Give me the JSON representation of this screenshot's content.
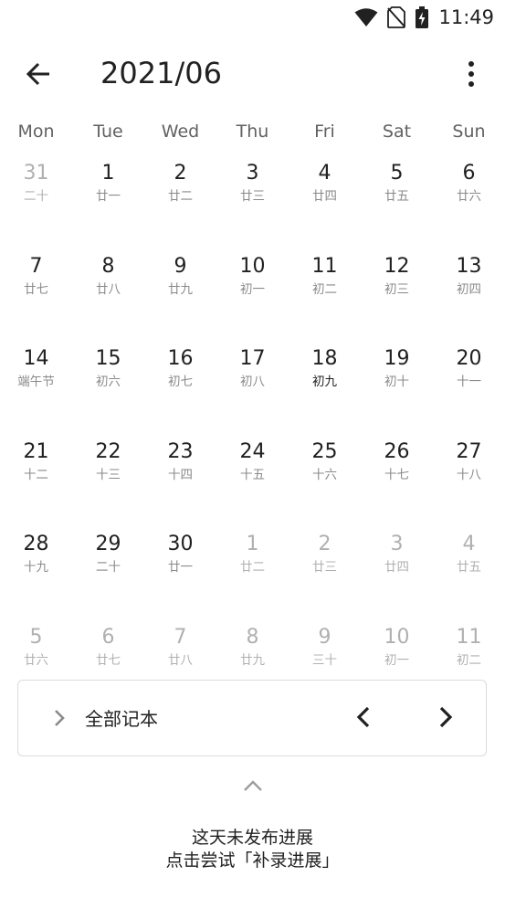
{
  "status_bar": {
    "time": "11:49",
    "icons": [
      "wifi-icon",
      "no-sim-icon",
      "battery-charging-icon"
    ]
  },
  "header": {
    "title": "2021/06",
    "back_icon": "arrow-left-icon",
    "menu_icon": "more-vertical-icon"
  },
  "weekdays": [
    "Mon",
    "Tue",
    "Wed",
    "Thu",
    "Fri",
    "Sat",
    "Sun"
  ],
  "weeks": [
    [
      {
        "day": "31",
        "lunar": "二十",
        "outside": true
      },
      {
        "day": "1",
        "lunar": "廿一"
      },
      {
        "day": "2",
        "lunar": "廿二"
      },
      {
        "day": "3",
        "lunar": "廿三"
      },
      {
        "day": "4",
        "lunar": "廿四"
      },
      {
        "day": "5",
        "lunar": "廿五"
      },
      {
        "day": "6",
        "lunar": "廿六"
      }
    ],
    [
      {
        "day": "7",
        "lunar": "廿七"
      },
      {
        "day": "8",
        "lunar": "廿八"
      },
      {
        "day": "9",
        "lunar": "廿九"
      },
      {
        "day": "10",
        "lunar": "初一"
      },
      {
        "day": "11",
        "lunar": "初二"
      },
      {
        "day": "12",
        "lunar": "初三"
      },
      {
        "day": "13",
        "lunar": "初四"
      }
    ],
    [
      {
        "day": "14",
        "lunar": "端午节"
      },
      {
        "day": "15",
        "lunar": "初六"
      },
      {
        "day": "16",
        "lunar": "初七"
      },
      {
        "day": "17",
        "lunar": "初八"
      },
      {
        "day": "18",
        "lunar": "初九",
        "today": true
      },
      {
        "day": "19",
        "lunar": "初十"
      },
      {
        "day": "20",
        "lunar": "十一"
      }
    ],
    [
      {
        "day": "21",
        "lunar": "十二"
      },
      {
        "day": "22",
        "lunar": "十三"
      },
      {
        "day": "23",
        "lunar": "十四"
      },
      {
        "day": "24",
        "lunar": "十五"
      },
      {
        "day": "25",
        "lunar": "十六"
      },
      {
        "day": "26",
        "lunar": "十七"
      },
      {
        "day": "27",
        "lunar": "十八"
      }
    ],
    [
      {
        "day": "28",
        "lunar": "十九"
      },
      {
        "day": "29",
        "lunar": "二十"
      },
      {
        "day": "30",
        "lunar": "廿一"
      },
      {
        "day": "1",
        "lunar": "廿二",
        "outside": true
      },
      {
        "day": "2",
        "lunar": "廿三",
        "outside": true
      },
      {
        "day": "3",
        "lunar": "廿四",
        "outside": true
      },
      {
        "day": "4",
        "lunar": "廿五",
        "outside": true
      }
    ],
    [
      {
        "day": "5",
        "lunar": "廿六",
        "outside": true
      },
      {
        "day": "6",
        "lunar": "廿七",
        "outside": true
      },
      {
        "day": "7",
        "lunar": "廿八",
        "outside": true
      },
      {
        "day": "8",
        "lunar": "廿九",
        "outside": true
      },
      {
        "day": "9",
        "lunar": "三十",
        "outside": true
      },
      {
        "day": "10",
        "lunar": "初一",
        "outside": true
      },
      {
        "day": "11",
        "lunar": "初二",
        "outside": true
      }
    ]
  ],
  "notebook_bar": {
    "label": "全部记本",
    "expand_icon": "chevron-right-icon",
    "prev_icon": "chevron-left-icon",
    "next_icon": "chevron-right-icon"
  },
  "collapse_icon": "chevron-up-icon",
  "empty_state": {
    "line1": "这天未发布进展",
    "line2": "点击尝试「补录进展」"
  },
  "colors": {
    "text": "#212121",
    "muted": "#8a8a8a",
    "outside": "#b0b0b0",
    "border": "#dcdcdc"
  }
}
